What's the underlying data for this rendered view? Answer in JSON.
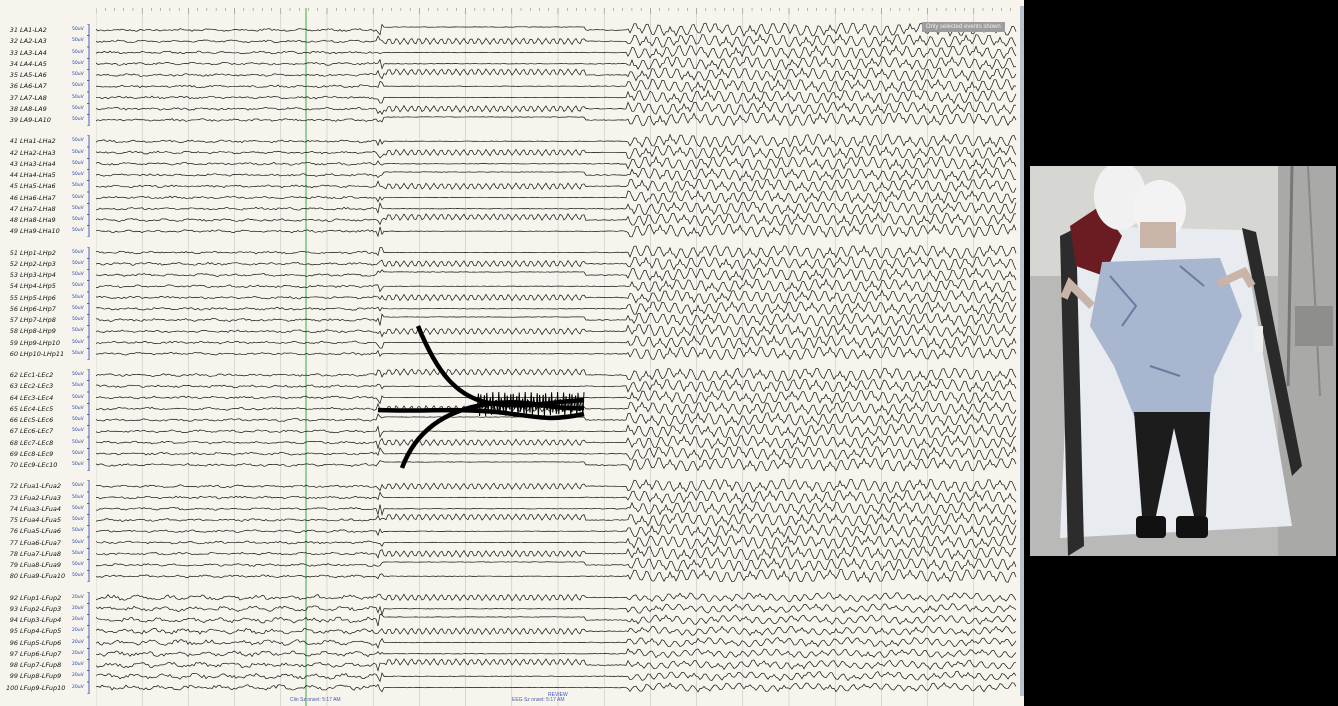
{
  "channel_groups": [
    {
      "rows": [
        {
          "num": "31",
          "name": "LA1-LA2",
          "gain": "50uV"
        },
        {
          "num": "32",
          "name": "LA2-LA3",
          "gain": "50uV"
        },
        {
          "num": "33",
          "name": "LA3-LA4",
          "gain": "50uV"
        },
        {
          "num": "34",
          "name": "LA4-LA5",
          "gain": "50uV"
        },
        {
          "num": "35",
          "name": "LA5-LA6",
          "gain": "50uV"
        },
        {
          "num": "36",
          "name": "LA6-LA7",
          "gain": "50uV"
        },
        {
          "num": "37",
          "name": "LA7-LA8",
          "gain": "50uV"
        },
        {
          "num": "38",
          "name": "LA8-LA9",
          "gain": "50uV"
        },
        {
          "num": "39",
          "name": "LA9-LA10",
          "gain": "50uV"
        }
      ]
    },
    {
      "rows": [
        {
          "num": "41",
          "name": "LHa1-LHa2",
          "gain": "50uV"
        },
        {
          "num": "42",
          "name": "LHa2-LHa3",
          "gain": "50uV"
        },
        {
          "num": "43",
          "name": "LHa3-LHa4",
          "gain": "50uV"
        },
        {
          "num": "44",
          "name": "LHa4-LHa5",
          "gain": "50uV"
        },
        {
          "num": "45",
          "name": "LHa5-LHa6",
          "gain": "50uV"
        },
        {
          "num": "46",
          "name": "LHa6-LHa7",
          "gain": "50uV"
        },
        {
          "num": "47",
          "name": "LHa7-LHa8",
          "gain": "50uV"
        },
        {
          "num": "48",
          "name": "LHa8-LHa9",
          "gain": "50uV"
        },
        {
          "num": "49",
          "name": "LHa9-LHa10",
          "gain": "50uV"
        }
      ]
    },
    {
      "rows": [
        {
          "num": "51",
          "name": "LHp1-LHp2",
          "gain": "50uV"
        },
        {
          "num": "52",
          "name": "LHp2-LHp3",
          "gain": "50uV"
        },
        {
          "num": "53",
          "name": "LHp3-LHp4",
          "gain": "50uV"
        },
        {
          "num": "54",
          "name": "LHp4-LHp5",
          "gain": "50uV"
        },
        {
          "num": "55",
          "name": "LHp5-LHp6",
          "gain": "50uV"
        },
        {
          "num": "56",
          "name": "LHp6-LHp7",
          "gain": "50uV"
        },
        {
          "num": "57",
          "name": "LHp7-LHp8",
          "gain": "50uV"
        },
        {
          "num": "58",
          "name": "LHp8-LHp9",
          "gain": "50uV"
        },
        {
          "num": "59",
          "name": "LHp9-LHp10",
          "gain": "50uV"
        },
        {
          "num": "60",
          "name": "LHp10-LHp11",
          "gain": "50uV"
        }
      ]
    },
    {
      "rows": [
        {
          "num": "62",
          "name": "LEc1-LEc2",
          "gain": "50uV"
        },
        {
          "num": "63",
          "name": "LEc2-LEc3",
          "gain": "50uV"
        },
        {
          "num": "64",
          "name": "LEc3-LEc4",
          "gain": "50uV"
        },
        {
          "num": "65",
          "name": "LEc4-LEc5",
          "gain": "50uV"
        },
        {
          "num": "66",
          "name": "LEc5-LEc6",
          "gain": "50uV"
        },
        {
          "num": "67",
          "name": "LEc6-LEc7",
          "gain": "50uV"
        },
        {
          "num": "68",
          "name": "LEc7-LEc8",
          "gain": "50uV"
        },
        {
          "num": "69",
          "name": "LEc8-LEc9",
          "gain": "50uV"
        },
        {
          "num": "70",
          "name": "LEc9-LEc10",
          "gain": "50uV"
        }
      ]
    },
    {
      "rows": [
        {
          "num": "72",
          "name": "LFua1-LFua2",
          "gain": "50uV"
        },
        {
          "num": "73",
          "name": "LFua2-LFua3",
          "gain": "50uV"
        },
        {
          "num": "74",
          "name": "LFua3-LFua4",
          "gain": "50uV"
        },
        {
          "num": "75",
          "name": "LFua4-LFua5",
          "gain": "50uV"
        },
        {
          "num": "76",
          "name": "LFua5-LFua6",
          "gain": "50uV"
        },
        {
          "num": "77",
          "name": "LFua6-LFua7",
          "gain": "50uV"
        },
        {
          "num": "78",
          "name": "LFua7-LFua8",
          "gain": "50uV"
        },
        {
          "num": "79",
          "name": "LFua8-LFua9",
          "gain": "50uV"
        },
        {
          "num": "80",
          "name": "LFua9-LFua10",
          "gain": "50uV"
        }
      ]
    },
    {
      "rows": [
        {
          "num": "92",
          "name": "LFup1-LFup2",
          "gain": "20uV"
        },
        {
          "num": "93",
          "name": "LFup2-LFup3",
          "gain": "20uV"
        },
        {
          "num": "94",
          "name": "LFup3-LFup4",
          "gain": "20uV"
        },
        {
          "num": "95",
          "name": "LFup4-LFup5",
          "gain": "20uV"
        },
        {
          "num": "96",
          "name": "LFup5-LFup6",
          "gain": "20uV"
        },
        {
          "num": "97",
          "name": "LFup6-LFup7",
          "gain": "20uV"
        },
        {
          "num": "98",
          "name": "LFup7-LFup8",
          "gain": "20uV"
        },
        {
          "num": "99",
          "name": "LFup8-LFup9",
          "gain": "20uV"
        },
        {
          "num": "100",
          "name": "LFup9-LFup10",
          "gain": "20uV"
        }
      ]
    }
  ],
  "overlay_badge": "Only selected events shown",
  "status_bar": {
    "left_event": "Clin Sz onset: 5:17 AM",
    "marker": "REVIEW",
    "right_event": "EEG Sz onset: 5:17 AM"
  },
  "colors": {
    "panel_bg": "#f6f4ec",
    "trace": "#111111",
    "grid": "#bcbcbc",
    "event_marker": "#3aa845",
    "gain_text": "#1d3fa8"
  },
  "video": {
    "content": "patient-on-hospital-bed",
    "description_hidden": true
  }
}
